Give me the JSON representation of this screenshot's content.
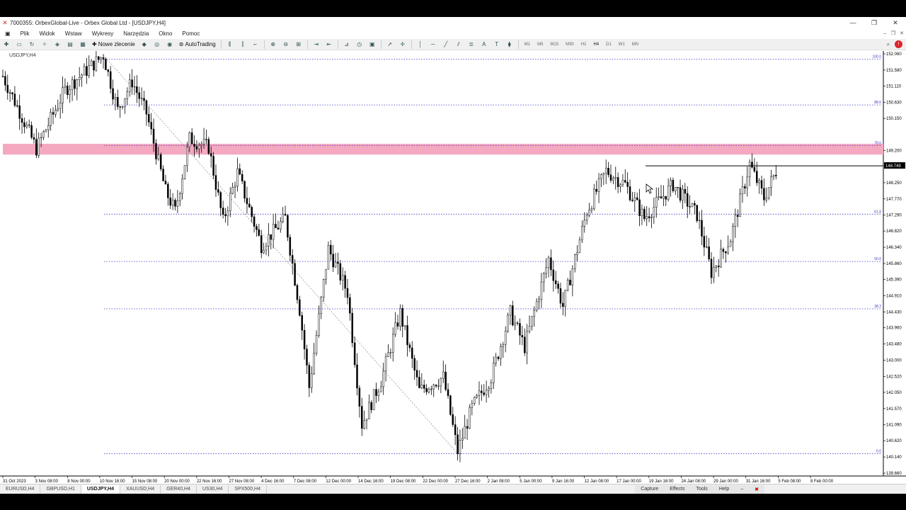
{
  "window": {
    "title": "7000355: OrbexGlobal-Live - Orbex Global Ltd - [USDJPY,H4]"
  },
  "menu": [
    "Plik",
    "Widok",
    "Wstaw",
    "Wykresy",
    "Narzędzia",
    "Okno",
    "Pomoc"
  ],
  "toolbar": {
    "new_order": "Nowe zlecenie",
    "autotrading": "AutoTrading"
  },
  "timeframes": [
    "M1",
    "M5",
    "M15",
    "M30",
    "H1",
    "H4",
    "D1",
    "W1",
    "MN"
  ],
  "chart": {
    "symbol": "USDJPY,H4"
  },
  "tabs": [
    "EURUSD,H4",
    "GBPUSD,H1",
    "USDJPY,H4",
    "XAUUSD,H4",
    "GER40,H4",
    "US30,H4",
    "SPX500,H4"
  ],
  "capture": [
    "Capture",
    "Effects",
    "Tools",
    "Help"
  ],
  "colors": {
    "candle": "#000000",
    "zone": "#f4a9c0",
    "fib": "#3a3ac8",
    "price_line": "#000000"
  },
  "chart_data": {
    "type": "candlestick",
    "symbol": "USDJPY",
    "timeframe": "H4",
    "ylim": [
      139.66,
      152.06
    ],
    "price_ticks": [
      "152.060",
      "151.580",
      "151.110",
      "150.630",
      "150.150",
      "149.200",
      "148.250",
      "147.770",
      "147.290",
      "146.820",
      "146.340",
      "145.860",
      "145.390",
      "144.910",
      "144.430",
      "143.960",
      "143.480",
      "143.000",
      "142.520",
      "142.050",
      "141.570",
      "141.090",
      "140.620",
      "140.140",
      "139.660"
    ],
    "current_price": "148.749",
    "time_ticks": [
      "31 Oct 2023",
      "3 Nov 08:00",
      "8 Nov 00:00",
      "10 Nov 16:00",
      "15 Nov 08:00",
      "20 Nov 00:00",
      "22 Nov 16:00",
      "27 Nov 08:00",
      "4 Dec 16:00",
      "7 Dec 08:00",
      "12 Dec 00:00",
      "14 Dec 16:00",
      "19 Dec 08:00",
      "22 Dec 00:00",
      "27 Dec 16:00",
      "2 Jan 08:00",
      "5 Jan 00:00",
      "9 Jan 16:00",
      "12 Jan 08:00",
      "17 Jan 00:00",
      "19 Jan 16:00",
      "24 Jan 08:00",
      "29 Jan 00:00",
      "31 Jan 16:00",
      "5 Feb 08:00",
      "8 Feb 00:00"
    ],
    "fib_levels": [
      {
        "label": "100.0",
        "price": 151.9
      },
      {
        "label": "88.6",
        "price": 150.55
      },
      {
        "label": "78.6",
        "price": 149.35
      },
      {
        "label": "61.8",
        "price": 147.32
      },
      {
        "label": "50.0",
        "price": 145.92
      },
      {
        "label": "38.2",
        "price": 144.52
      },
      {
        "label": "0.0",
        "price": 140.24
      }
    ],
    "zone": {
      "high": 149.4,
      "low": 149.08
    },
    "path": [
      {
        "idx": 0,
        "price": 151.4
      },
      {
        "idx": 8,
        "price": 150.2
      },
      {
        "idx": 14,
        "price": 149.25
      },
      {
        "idx": 26,
        "price": 151.0
      },
      {
        "idx": 42,
        "price": 152.02
      },
      {
        "idx": 48,
        "price": 150.4
      },
      {
        "idx": 54,
        "price": 151.25
      },
      {
        "idx": 60,
        "price": 150.3
      },
      {
        "idx": 68,
        "price": 148.0
      },
      {
        "idx": 72,
        "price": 147.4
      },
      {
        "idx": 78,
        "price": 149.55
      },
      {
        "idx": 86,
        "price": 149.3
      },
      {
        "idx": 92,
        "price": 147.1
      },
      {
        "idx": 98,
        "price": 148.55
      },
      {
        "idx": 108,
        "price": 146.4
      },
      {
        "idx": 118,
        "price": 147.2
      },
      {
        "idx": 124,
        "price": 144.5
      },
      {
        "idx": 128,
        "price": 142.2
      },
      {
        "idx": 136,
        "price": 146.3
      },
      {
        "idx": 144,
        "price": 145.0
      },
      {
        "idx": 150,
        "price": 141.1
      },
      {
        "idx": 158,
        "price": 142.4
      },
      {
        "idx": 166,
        "price": 144.4
      },
      {
        "idx": 174,
        "price": 142.1
      },
      {
        "idx": 184,
        "price": 142.5
      },
      {
        "idx": 190,
        "price": 140.3
      },
      {
        "idx": 196,
        "price": 141.6
      },
      {
        "idx": 204,
        "price": 142.5
      },
      {
        "idx": 212,
        "price": 144.4
      },
      {
        "idx": 218,
        "price": 143.4
      },
      {
        "idx": 228,
        "price": 146.0
      },
      {
        "idx": 234,
        "price": 144.6
      },
      {
        "idx": 244,
        "price": 147.4
      },
      {
        "idx": 252,
        "price": 148.6
      },
      {
        "idx": 260,
        "price": 148.2
      },
      {
        "idx": 268,
        "price": 147.2
      },
      {
        "idx": 280,
        "price": 148.2
      },
      {
        "idx": 290,
        "price": 147.3
      },
      {
        "idx": 296,
        "price": 145.6
      },
      {
        "idx": 304,
        "price": 146.6
      },
      {
        "idx": 312,
        "price": 148.8
      },
      {
        "idx": 318,
        "price": 147.8
      },
      {
        "idx": 324,
        "price": 148.75
      }
    ]
  }
}
